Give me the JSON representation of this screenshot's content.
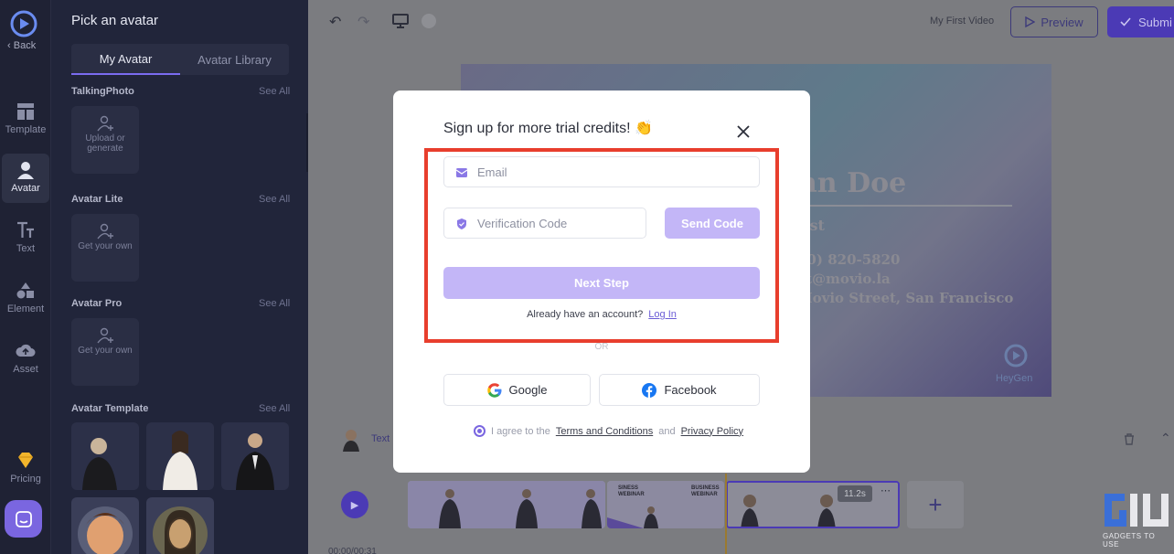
{
  "rail": {
    "back_label": "Back",
    "items": [
      {
        "label": "Template",
        "icon": "template-icon"
      },
      {
        "label": "Avatar",
        "icon": "avatar-icon"
      },
      {
        "label": "Text",
        "icon": "text-icon"
      },
      {
        "label": "Element",
        "icon": "element-icon"
      },
      {
        "label": "Asset",
        "icon": "asset-icon"
      },
      {
        "label": "Pricing",
        "icon": "pricing-diamond-icon"
      }
    ]
  },
  "panel": {
    "title": "Pick an avatar",
    "tabs": [
      "My Avatar",
      "Avatar Library"
    ],
    "sections": [
      {
        "title": "TalkingPhoto",
        "see_all": "See All",
        "card": "Upload or generate"
      },
      {
        "title": "Avatar Lite",
        "see_all": "See All",
        "card": "Get your own"
      },
      {
        "title": "Avatar Pro",
        "see_all": "See All",
        "card": "Get your own"
      },
      {
        "title": "Avatar Template",
        "see_all": "See All"
      }
    ]
  },
  "topbar": {
    "video_name": "My First Video",
    "preview_label": "Preview",
    "submit_label": "Submi"
  },
  "canvas": {
    "name": "hn Doe",
    "role": "tist",
    "phone": "00) 820-5820",
    "email": "ct@movio.la",
    "address": "Movio Street, San Francisco",
    "brand": "HeyGen"
  },
  "timeline": {
    "script_label": "Text",
    "duration": "11.2s",
    "time": "00:00/00:31",
    "clip2_title_a": "SINESS",
    "clip2_title_b": "WEBINAR",
    "clip2_title_c": "BUSINESS",
    "clip2_title_d": "WEBINAR"
  },
  "modal": {
    "title": "Sign up for more trial credits! 👏",
    "email_placeholder": "Email",
    "code_placeholder": "Verification Code",
    "send_code": "Send Code",
    "next_step": "Next Step",
    "have_account": "Already have an account?",
    "login": "Log In",
    "or": "OR",
    "google": "Google",
    "facebook": "Facebook",
    "agree_prefix": "I agree to the",
    "terms": "Terms and Conditions",
    "and": "and",
    "privacy": "Privacy Policy"
  },
  "watermark": {
    "text": "GADGETS TO USE"
  },
  "colors": {
    "accent": "#7a66e0",
    "highlight": "#e83e2d",
    "button_light": "#c3b6f7"
  }
}
